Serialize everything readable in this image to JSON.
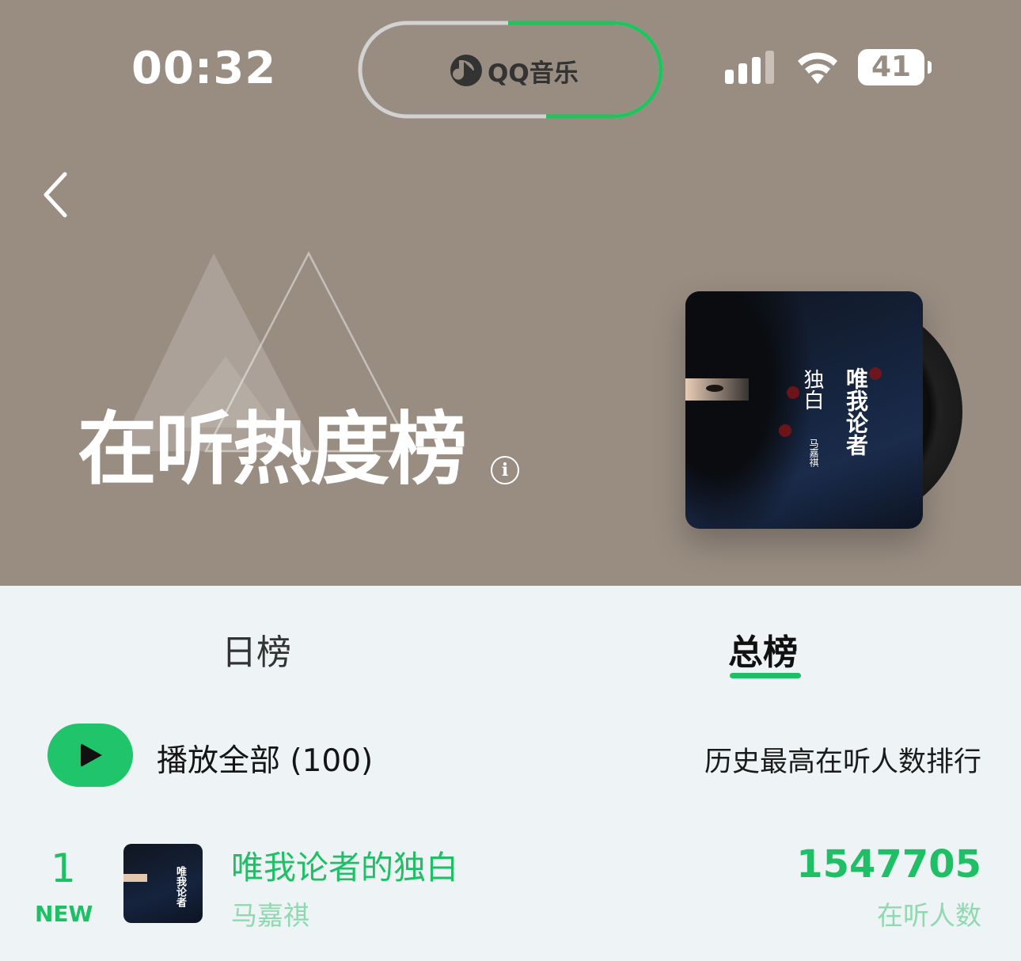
{
  "status_bar": {
    "time": "00:32",
    "island_app": "QQ音乐",
    "battery": "41"
  },
  "header": {
    "title": "在听热度榜",
    "info_icon": "info-icon",
    "back_icon": "chevron-left-icon",
    "cover": {
      "title": "唯我论者",
      "subtitle": "独白",
      "artist": "马嘉祺"
    }
  },
  "tabs": [
    {
      "label": "日榜",
      "active": false
    },
    {
      "label": "总榜",
      "active": true
    }
  ],
  "toolbar": {
    "play_all_label": "播放全部 (100)",
    "history_label": "历史最高在听人数排行"
  },
  "list": [
    {
      "rank": "1",
      "badge": "NEW",
      "title": "唯我论者的独白",
      "artist": "马嘉祺",
      "listeners": "1547705",
      "listeners_label": "在听人数"
    }
  ],
  "colors": {
    "hero_bg": "#998d82",
    "accent": "#1fbf66",
    "page_bg": "#eef3f5"
  }
}
